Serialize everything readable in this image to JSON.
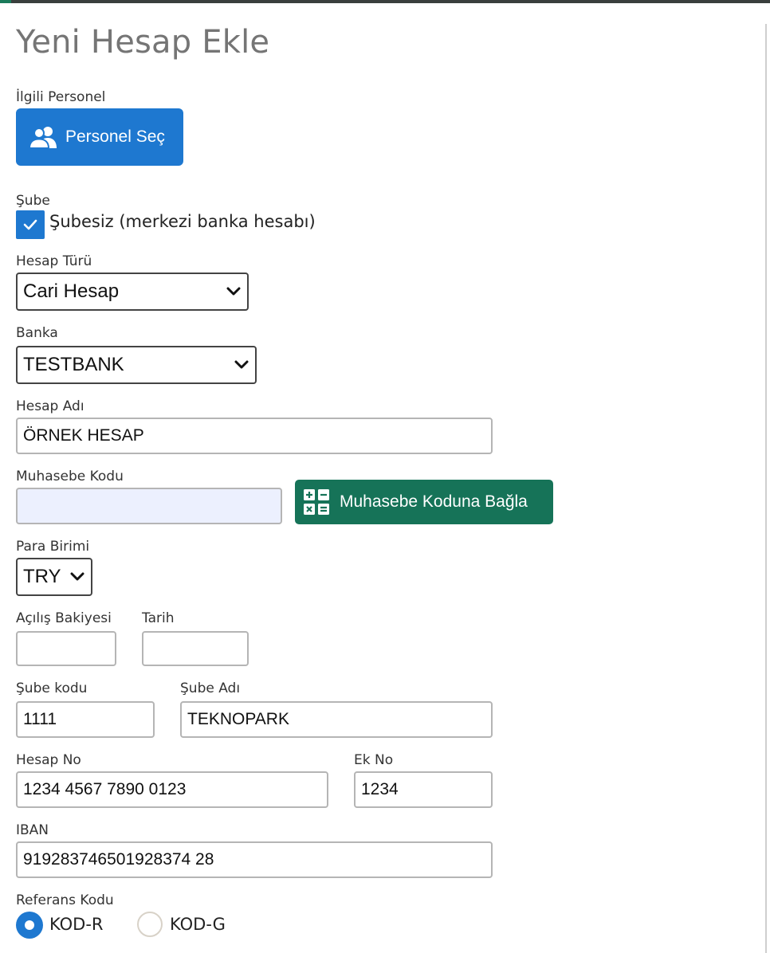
{
  "page": {
    "title": "Yeni Hesap Ekle"
  },
  "personel": {
    "label": "İlgili Personel",
    "button_label": "Personel Seç",
    "icon": "users-icon"
  },
  "sube": {
    "label": "Şube",
    "checkbox_label": "Şubesiz (merkezi banka hesabı)",
    "checked": true
  },
  "hesap_turu": {
    "label": "Hesap Türü",
    "value": "Cari Hesap"
  },
  "banka": {
    "label": "Banka",
    "value": "TESTBANK"
  },
  "hesap_adi": {
    "label": "Hesap Adı",
    "value": "ÖRNEK HESAP"
  },
  "muhasebe_kodu": {
    "label": "Muhasebe Kodu",
    "value": "",
    "button_label": "Muhasebe Koduna Bağla",
    "icon": "calculator-icon"
  },
  "para_birimi": {
    "label": "Para Birimi",
    "value": "TRY"
  },
  "acilis_bakiyesi": {
    "label": "Açılış Bakiyesi",
    "value": ""
  },
  "tarih": {
    "label": "Tarih",
    "value": ""
  },
  "sube_kodu": {
    "label": "Şube kodu",
    "value": "1111"
  },
  "sube_adi": {
    "label": "Şube Adı",
    "value": "TEKNOPARK"
  },
  "hesap_no": {
    "label": "Hesap No",
    "value": "1234 4567 7890 0123"
  },
  "ek_no": {
    "label": "Ek No",
    "value": "1234"
  },
  "iban": {
    "label": "IBAN",
    "value": "919283746501928374 28"
  },
  "referans_kodu": {
    "label": "Referans Kodu",
    "options": [
      {
        "label": "KOD-R",
        "selected": true
      },
      {
        "label": "KOD-G",
        "selected": false
      }
    ]
  },
  "colors": {
    "primary_blue": "#1e78d0",
    "green_button": "#167358",
    "title_gray": "#757575"
  }
}
